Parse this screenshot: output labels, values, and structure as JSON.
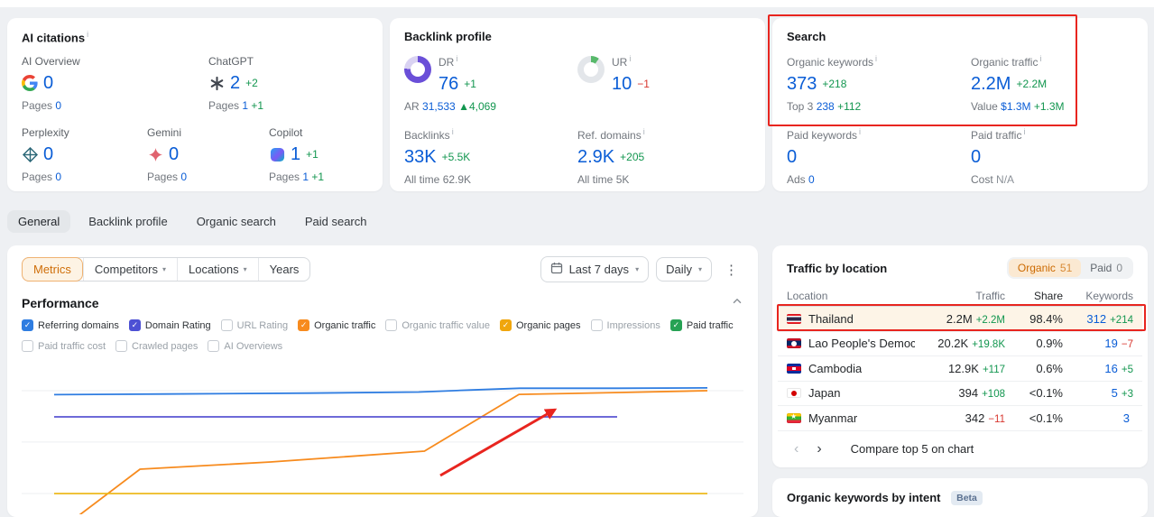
{
  "colors": {
    "link_blue": "#0a5dd6",
    "positive_green": "#12964f",
    "negative_red": "#d8372f",
    "orange_accent": "#cf6e09",
    "annotation_red": "#e8251f"
  },
  "ai_citations": {
    "title": "AI citations",
    "items": [
      {
        "name": "AI Overview",
        "icon": "google-icon",
        "value": "0",
        "change": "",
        "pages_label": "Pages",
        "pages_value": "0",
        "pages_change": ""
      },
      {
        "name": "ChatGPT",
        "icon": "chatgpt-icon",
        "value": "2",
        "change": "+2",
        "pages_label": "Pages",
        "pages_value": "1",
        "pages_change": "+1"
      },
      {
        "name": "Perplexity",
        "icon": "perplexity-icon",
        "value": "0",
        "change": "",
        "pages_label": "Pages",
        "pages_value": "0",
        "pages_change": ""
      },
      {
        "name": "Gemini",
        "icon": "gemini-icon",
        "value": "0",
        "change": "",
        "pages_label": "Pages",
        "pages_value": "0",
        "pages_change": ""
      },
      {
        "name": "Copilot",
        "icon": "copilot-icon",
        "value": "1",
        "change": "+1",
        "pages_label": "Pages",
        "pages_value": "1",
        "pages_change": "+1"
      }
    ]
  },
  "backlink_profile": {
    "title": "Backlink profile",
    "dr": {
      "label": "DR",
      "value": "76",
      "change": "+1",
      "ar_label": "AR",
      "ar_value": "31,533",
      "ar_change": "▲4,069"
    },
    "ur": {
      "label": "UR",
      "value": "10",
      "change": "−1"
    },
    "backlinks": {
      "label": "Backlinks",
      "value": "33K",
      "change": "+5.5K",
      "alltime_label": "All time",
      "alltime_value": "62.9K"
    },
    "ref_domains": {
      "label": "Ref. domains",
      "value": "2.9K",
      "change": "+205",
      "alltime_label": "All time",
      "alltime_value": "5K"
    }
  },
  "search": {
    "title": "Search",
    "cols": [
      {
        "label": "Organic keywords",
        "value": "373",
        "change": "+218",
        "sub_label": "Top 3",
        "sub_value": "238",
        "sub_change": "+112"
      },
      {
        "label": "Organic traffic",
        "value": "2.2M",
        "change": "+2.2M",
        "sub_label": "Value",
        "sub_value": "$1.3M",
        "sub_change": "+1.3M"
      },
      {
        "label": "Paid keywords",
        "value": "0",
        "change": "",
        "sub_label": "Ads",
        "sub_value": "0",
        "sub_change": ""
      },
      {
        "label": "Paid traffic",
        "value": "0",
        "change": "",
        "sub_label": "Cost",
        "sub_value": "N/A",
        "sub_change": ""
      }
    ]
  },
  "tabs": [
    {
      "label": "General"
    },
    {
      "label": "Backlink profile"
    },
    {
      "label": "Organic search"
    },
    {
      "label": "Paid search"
    }
  ],
  "performance": {
    "title": "Performance",
    "toolbar": {
      "metrics": "Metrics",
      "competitors": "Competitors",
      "locations": "Locations",
      "years": "Years",
      "date_range": "Last 7 days",
      "granularity": "Daily"
    },
    "metrics": [
      {
        "label": "Referring domains",
        "checked": true,
        "color": "#2f7de1"
      },
      {
        "label": "Domain Rating",
        "checked": true,
        "color": "#4d51d4"
      },
      {
        "label": "URL Rating",
        "checked": false
      },
      {
        "label": "Organic traffic",
        "checked": true,
        "color": "#f78b1e"
      },
      {
        "label": "Organic traffic value",
        "checked": false
      },
      {
        "label": "Organic pages",
        "checked": true,
        "color": "#f0a60d"
      },
      {
        "label": "Impressions",
        "checked": false
      },
      {
        "label": "Paid traffic",
        "checked": true,
        "color": "#27a254"
      },
      {
        "label": "Paid traffic cost",
        "checked": false
      },
      {
        "label": "Crawled pages",
        "checked": false
      },
      {
        "label": "AI Overviews",
        "checked": false
      }
    ]
  },
  "chart_data": {
    "type": "line",
    "title": "Performance",
    "x_range_label": "Last 7 days, daily",
    "axis_labels_visible": false,
    "grid": true,
    "legend_position": "checkbox-row-above-chart",
    "series": [
      {
        "name": "Referring domains",
        "color": "#2f7de1",
        "approx_latest_value": "2.9K",
        "points_pct": [
          [
            4.5,
            22
          ],
          [
            20,
            21.6
          ],
          [
            40,
            21
          ],
          [
            55,
            20.3
          ],
          [
            62,
            19
          ],
          [
            69,
            17.8
          ],
          [
            82.5,
            17.8
          ],
          [
            95,
            17.6
          ]
        ]
      },
      {
        "name": "Organic traffic",
        "color": "#f78b1e",
        "approx_latest_value": "2.2M",
        "points_pct": [
          [
            7.3,
            103
          ],
          [
            16.4,
            70.6
          ],
          [
            34.5,
            65.9
          ],
          [
            55.8,
            58.8
          ],
          [
            68.9,
            21.8
          ],
          [
            83,
            20.6
          ],
          [
            95,
            19.4
          ]
        ]
      },
      {
        "name": "Domain Rating",
        "color": "#5a55d2",
        "approx_latest_value": "76",
        "points_pct": [
          [
            4.5,
            36.5
          ],
          [
            82.5,
            36.5
          ]
        ]
      },
      {
        "name": "Organic pages",
        "color": "#edba1e",
        "approx_latest_value": "1",
        "points_pct": [
          [
            4.5,
            86.5
          ],
          [
            95,
            86.5
          ]
        ]
      }
    ],
    "gridlines_pct": [
      19.4,
      52.9,
      86.5
    ]
  },
  "traffic_by_location": {
    "title": "Traffic by location",
    "toggle": {
      "organic_label": "Organic",
      "organic_count": "51",
      "paid_label": "Paid",
      "paid_count": "0"
    },
    "columns": {
      "location": "Location",
      "traffic": "Traffic",
      "share": "Share",
      "keywords": "Keywords"
    },
    "rows": [
      {
        "flag": "th",
        "country": "Thailand",
        "traffic": "2.2M",
        "traffic_change": "+2.2M",
        "share": "98.4%",
        "keywords": "312",
        "keywords_change": "+214"
      },
      {
        "flag": "la",
        "country": "Lao People's Democratic Reput",
        "traffic": "20.2K",
        "traffic_change": "+19.8K",
        "share": "0.9%",
        "keywords": "19",
        "keywords_change": "−7"
      },
      {
        "flag": "kh",
        "country": "Cambodia",
        "traffic": "12.9K",
        "traffic_change": "+117",
        "share": "0.6%",
        "keywords": "16",
        "keywords_change": "+5"
      },
      {
        "flag": "jp",
        "country": "Japan",
        "traffic": "394",
        "traffic_change": "+108",
        "share": "<0.1%",
        "keywords": "5",
        "keywords_change": "+3"
      },
      {
        "flag": "mm",
        "country": "Myanmar",
        "traffic": "342",
        "traffic_change": "−11",
        "share": "<0.1%",
        "keywords": "3",
        "keywords_change": ""
      }
    ],
    "footer_link": "Compare top 5 on chart"
  },
  "organic_intent": {
    "title": "Organic keywords by intent",
    "badge": "Beta"
  }
}
